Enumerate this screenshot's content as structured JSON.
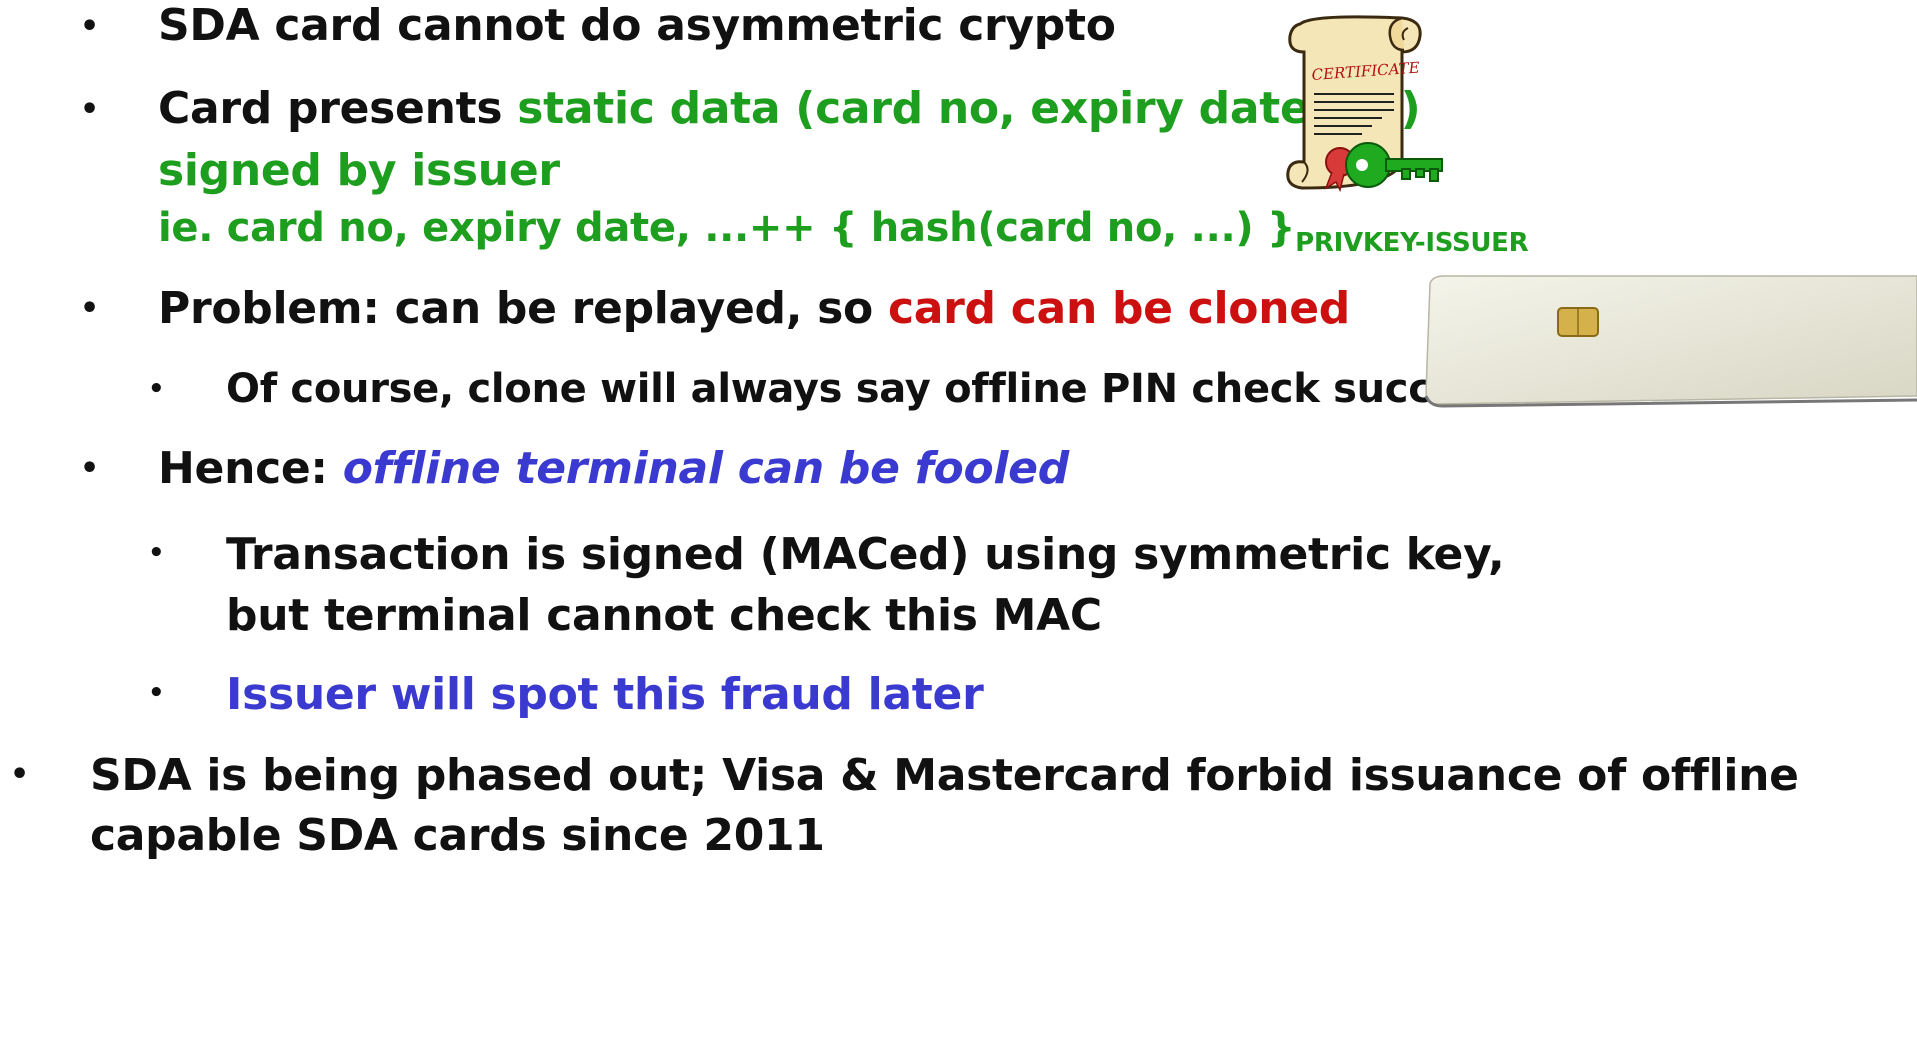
{
  "bullets": {
    "b1": "SDA card cannot do asymmetric crypto",
    "b2": {
      "pre": "Card presents ",
      "green": "static data (card no, expiry date etc)",
      "line2": "signed by issuer",
      "line3": "ie. card no, expiry date, ...++ { hash(card no, ...) }",
      "line3_sub": "PRIVKEY-ISSUER"
    },
    "b3": {
      "pre": "Problem: can be replayed,  so ",
      "red": "card can be cloned"
    },
    "b3_sub": "Of course, clone will always say offline PIN check succeeded",
    "b4": {
      "pre": "Hence: ",
      "blue": "offline terminal can be fooled"
    },
    "b4_sub1": {
      "line1": "Transaction is signed (MACed) using symmetric key,",
      "line2": "but terminal cannot check this MAC"
    },
    "b4_sub2": "Issuer will spot this fraud later",
    "b5": {
      "line1": "SDA is being phased out; Visa & Mastercard forbid issuance of offline",
      "line2": "capable SDA cards since 2011"
    }
  },
  "certificate": {
    "label": "CERTIFICATE",
    "icon": "certificate-scroll-icon",
    "key_icon": "green-key-icon"
  },
  "card_image": {
    "icon": "smart-card-icon"
  },
  "colors": {
    "green": "#1e9e1e",
    "red": "#cc1010",
    "blue": "#3a3ad0",
    "text": "#111111"
  }
}
